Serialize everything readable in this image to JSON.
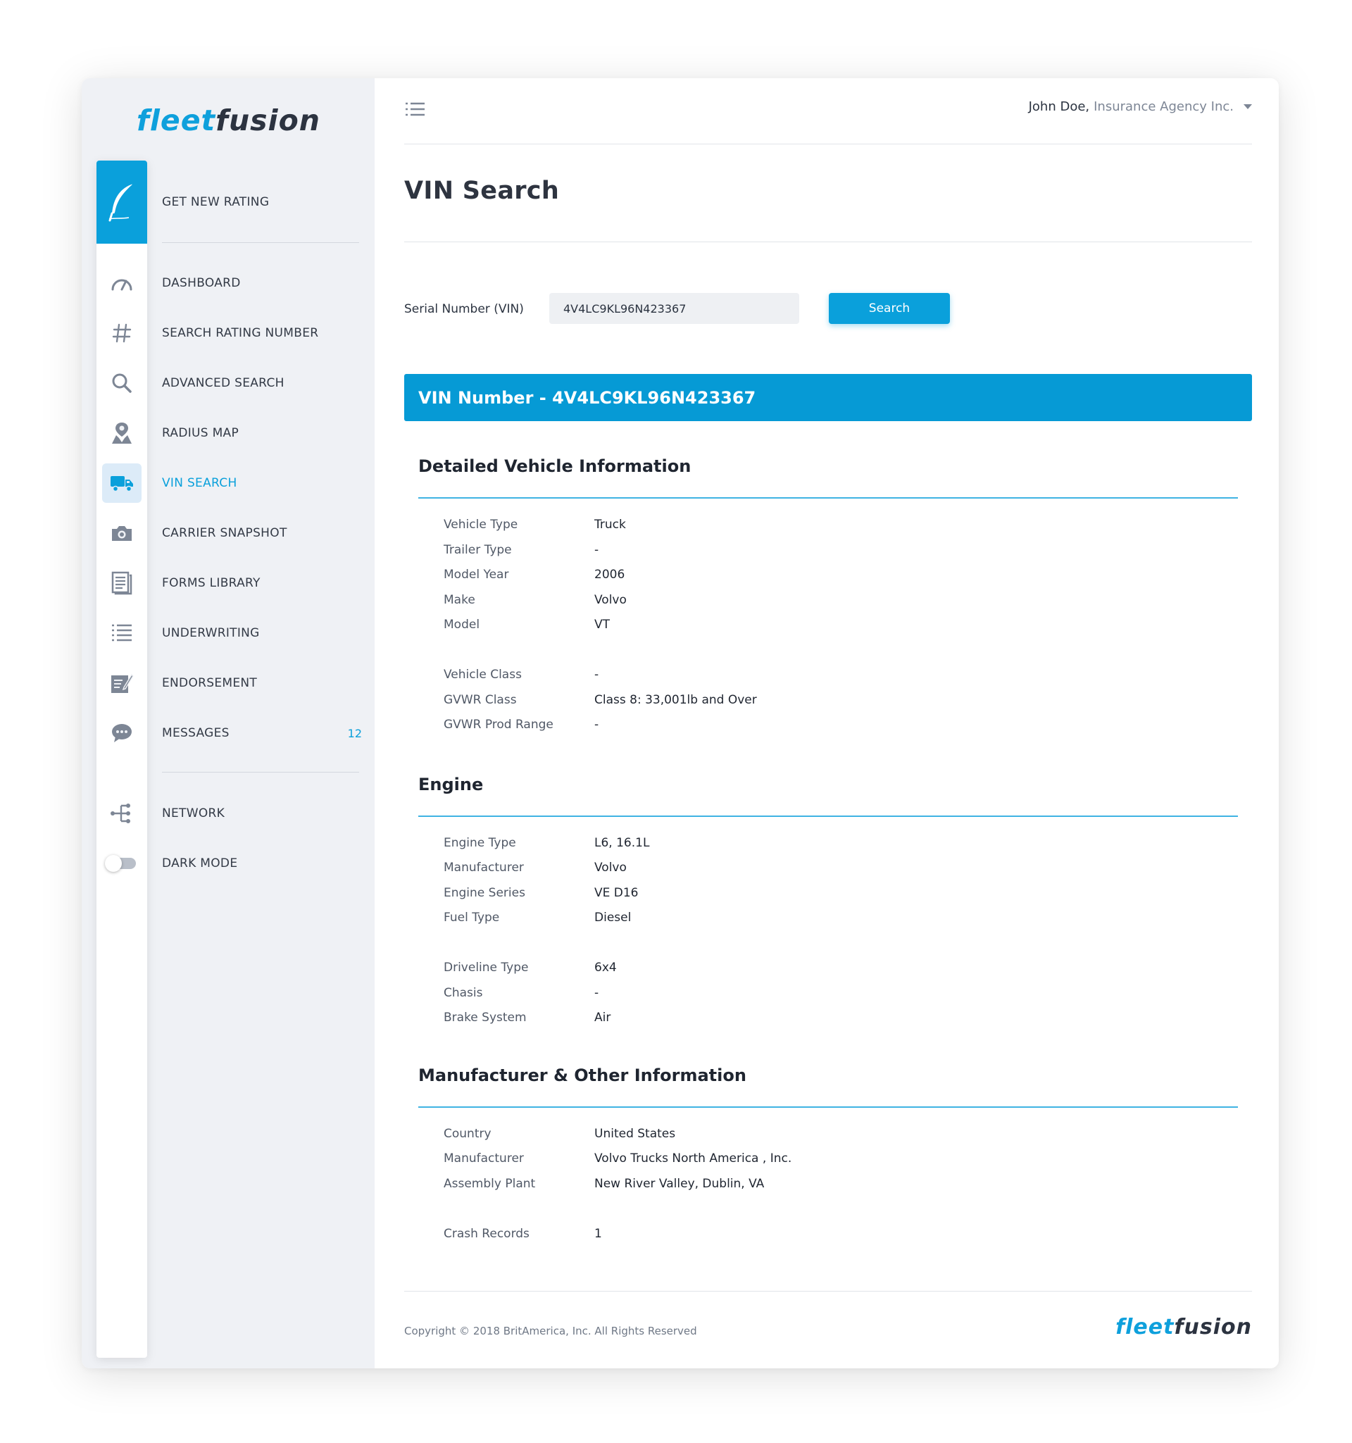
{
  "brand": {
    "part1": "fleet",
    "part2": "fusion"
  },
  "colors": {
    "accent": "#0aa0db",
    "sidebar_bg": "#eff1f5",
    "rule": "#3fb3e3"
  },
  "sidebar": {
    "primary": {
      "label": "GET NEW RATING",
      "icon": "feather-icon"
    },
    "items": [
      {
        "label": "DASHBOARD",
        "icon": "speedometer-icon"
      },
      {
        "label": "SEARCH RATING NUMBER",
        "icon": "hash-icon"
      },
      {
        "label": "ADVANCED SEARCH",
        "icon": "search-icon"
      },
      {
        "label": "RADIUS MAP",
        "icon": "map-pin-icon"
      },
      {
        "label": "VIN SEARCH",
        "icon": "truck-icon",
        "active": true
      },
      {
        "label": "CARRIER SNAPSHOT",
        "icon": "camera-icon"
      },
      {
        "label": "FORMS LIBRARY",
        "icon": "document-icon"
      },
      {
        "label": "UNDERWRITING",
        "icon": "list-icon"
      },
      {
        "label": "ENDORSEMENT",
        "icon": "edit-icon"
      },
      {
        "label": "MESSAGES",
        "icon": "chat-bubble-icon",
        "badge": "12"
      }
    ],
    "secondary": [
      {
        "label": "NETWORK",
        "icon": "network-icon"
      },
      {
        "label": "DARK MODE",
        "icon": "toggle-icon",
        "toggle_on": false
      }
    ]
  },
  "header": {
    "user_name": "John Doe,",
    "organization": "Insurance Agency Inc."
  },
  "page": {
    "title": "VIN Search",
    "search": {
      "label": "Serial Number (VIN)",
      "value": "4V4LC9KL96N423367",
      "button": "Search"
    },
    "banner": "VIN Number - 4V4LC9KL96N423367"
  },
  "sections": {
    "vehicle": {
      "title": "Detailed Vehicle Information",
      "rows": [
        {
          "k": "Vehicle Type",
          "v": "Truck"
        },
        {
          "k": "Trailer Type",
          "v": "-"
        },
        {
          "k": "Model Year",
          "v": "2006"
        },
        {
          "k": "Make",
          "v": "Volvo"
        },
        {
          "k": "Model",
          "v": "VT"
        },
        {
          "k": "Vehicle Class",
          "v": "-"
        },
        {
          "k": "GVWR Class",
          "v": "Class 8: 33,001lb and Over"
        },
        {
          "k": "GVWR Prod Range",
          "v": "-"
        }
      ]
    },
    "engine": {
      "title": "Engine",
      "rows": [
        {
          "k": "Engine Type",
          "v": "L6, 16.1L"
        },
        {
          "k": "Manufacturer",
          "v": "Volvo"
        },
        {
          "k": "Engine Series",
          "v": "VE D16"
        },
        {
          "k": "Fuel Type",
          "v": "Diesel"
        },
        {
          "k": "Driveline Type",
          "v": "6x4"
        },
        {
          "k": "Chasis",
          "v": "-"
        },
        {
          "k": "Brake System",
          "v": "Air"
        }
      ]
    },
    "manufacturer": {
      "title": "Manufacturer & Other Information",
      "rows": [
        {
          "k": "Country",
          "v": "United States"
        },
        {
          "k": "Manufacturer",
          "v": "Volvo Trucks North America , Inc."
        },
        {
          "k": "Assembly Plant",
          "v": "New River Valley, Dublin, VA"
        },
        {
          "k": "Crash Records",
          "v": "1"
        }
      ]
    }
  },
  "footer": {
    "copyright": "Copyright © 2018 BritAmerica, Inc. All Rights Reserved"
  }
}
